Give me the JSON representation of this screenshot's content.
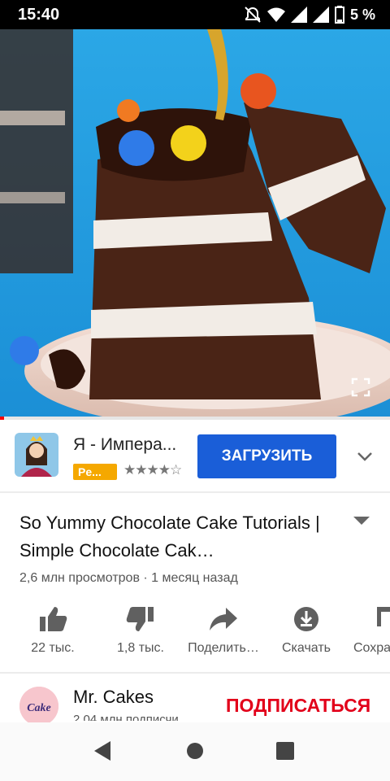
{
  "status": {
    "time": "15:40",
    "battery": "5 %",
    "icons": [
      "alarm-off-icon",
      "wifi-icon",
      "signal-icon",
      "signal-icon",
      "battery-icon"
    ]
  },
  "video": {
    "progress_fraction": 0.01,
    "fullscreen_icon": "fullscreen-icon"
  },
  "ad": {
    "title": "Я - Импера...",
    "tag": "Pe...",
    "rating_stars": "★★★★☆",
    "rating_value": 4,
    "install_label": "ЗАГРУЗИТЬ",
    "expand_icon": "chevron-down-icon"
  },
  "video_info": {
    "title": "So Yummy Chocolate Cake Tutorials | Simple Chocolate Cak…",
    "views": "2,6 млн просмотров",
    "age": "1 месяц назад",
    "meta_separator": " · "
  },
  "actions": [
    {
      "icon": "thumbs-up-icon",
      "label": "22 тыс."
    },
    {
      "icon": "thumbs-down-icon",
      "label": "1,8 тыс."
    },
    {
      "icon": "share-icon",
      "label": "Поделить…"
    },
    {
      "icon": "download-icon",
      "label": "Скачать"
    },
    {
      "icon": "save-icon",
      "label": "Сохра"
    }
  ],
  "channel": {
    "name": "Mr. Cakes",
    "subscribers": "2,04 млн подписчи",
    "avatar_text": "Cake",
    "subscribe_label": "ПОДПИСАТЬСЯ"
  },
  "colors": {
    "accent_blue": "#1a5ed8",
    "subscribe_red": "#e2001a",
    "progress_red": "#ff0000",
    "ad_tag": "#f5a800"
  }
}
